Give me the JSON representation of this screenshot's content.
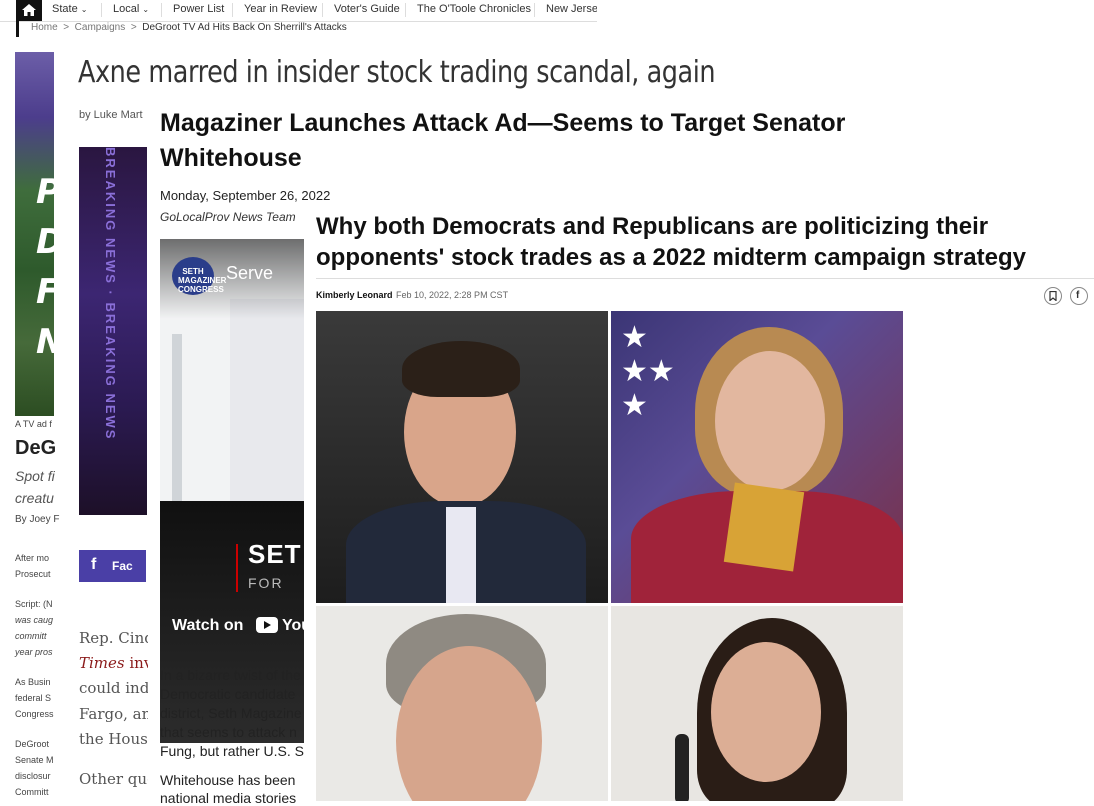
{
  "nav": {
    "items": [
      "State",
      "Local",
      "Power List",
      "Year in Review",
      "Voter's Guide",
      "The O'Toole Chronicles",
      "New Jersey"
    ]
  },
  "breadcrumb": {
    "home": "Home",
    "sep": ">",
    "campaigns": "Campaigns",
    "current": "DeGroot TV Ad Hits Back On Sherrill's Attacks"
  },
  "left_article": {
    "caption": "A TV ad f",
    "title": "DeG",
    "sub1": "Spot fi",
    "sub2": "creatu",
    "byline": "By Joey F",
    "p1a": "After mo",
    "p1b": "Prosecut",
    "p2a": "Script: (N",
    "p2b": "was caug",
    "p2c": "committ",
    "p2d": "year pros",
    "p3a": "As Busin",
    "p3b": "federal S",
    "p3c": "Congress",
    "p4a": "DeGroot",
    "p4b": "Senate M",
    "p4c": "disclosur",
    "p4d": "Committ"
  },
  "axne": {
    "title": "Axne marred in insider stock trading scandal, again",
    "byline": "by Luke Mart",
    "banner_text": "BREAKING NEWS · BREAKING NEWS",
    "share_label": "Fac",
    "p1": "Rep. Cindy",
    "p2a": "Times",
    "p2b": " inve",
    "p3": "could indic",
    "p4": "Fargo, and",
    "p5": "the House",
    "p6": "Other que"
  },
  "magaziner": {
    "title": "Magaziner Launches Attack Ad—Seems to Target Senator Whitehouse",
    "date": "Monday, September 26, 2022",
    "team": "GoLocalProv News Team",
    "video": {
      "logo_text": "SETH MAGAZINER CONGRESS",
      "serve": "Serve",
      "set": "SET",
      "fo": "FOR",
      "watch_on": "Watch on",
      "youtube": "YouT"
    },
    "lines": [
      "In a bizarre twist of the",
      "Democratic candidate",
      "district, Seth Magazine",
      "that seems to attack n",
      "Fung, but rather U.S. S",
      "Whitehouse has been",
      "national media stories"
    ]
  },
  "insider": {
    "title_line1": "Why both Democrats and Republicans are politicizing their",
    "title_line2": "opponents' stock trades as a 2022 midterm campaign strategy",
    "author": "Kimberly Leonard",
    "date": "Feb 10, 2022, 2:28 PM CST",
    "bookmark_icon": "bookmark-icon",
    "facebook_icon": "facebook-icon"
  },
  "colors": {
    "nav_home_bg": "#111111",
    "banner_purple": "#3c2672",
    "fb_blue": "#4a3fa6",
    "times_red": "#8b1a1a"
  }
}
